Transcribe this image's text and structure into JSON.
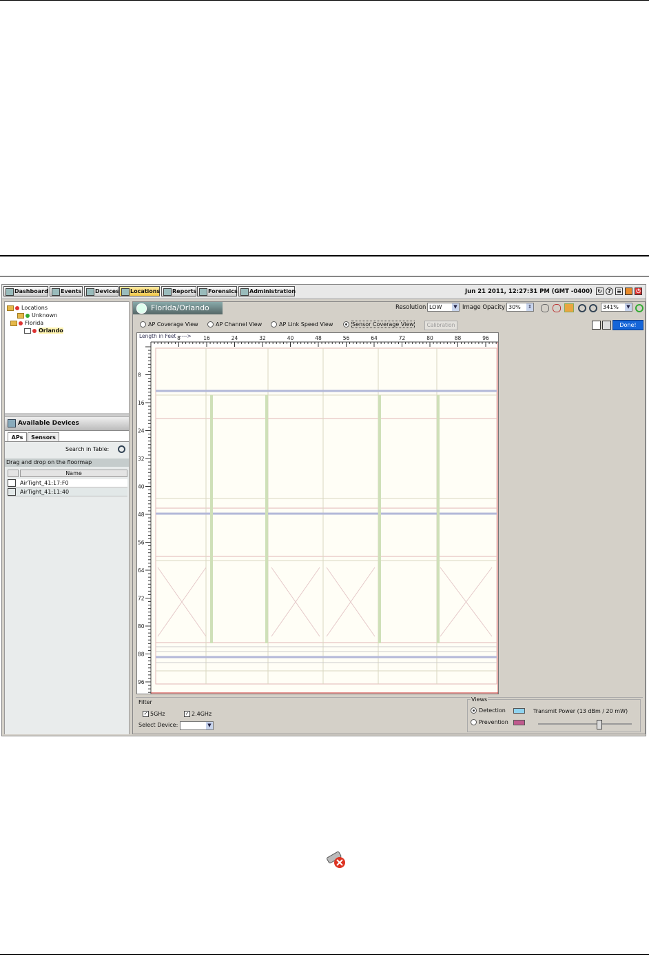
{
  "nav": [
    {
      "label": "Dashboard",
      "icon": "dashboard-icon"
    },
    {
      "label": "Events",
      "icon": "events-icon"
    },
    {
      "label": "Devices",
      "icon": "devices-icon"
    },
    {
      "label": "Locations",
      "icon": "locations-icon",
      "active": true
    },
    {
      "label": "Reports",
      "icon": "reports-icon"
    },
    {
      "label": "Forensics",
      "icon": "forensics-icon"
    },
    {
      "label": "Administration",
      "icon": "administration-icon"
    }
  ],
  "datetime": "Jun 21 2011, 12:27:31 PM (GMT -0400)",
  "tree": {
    "root": "Locations",
    "items": [
      {
        "label": "Unknown",
        "status": "green"
      },
      {
        "label": "Florida",
        "status": "red"
      },
      {
        "label": "Orlando",
        "status": "red",
        "selected": true
      }
    ]
  },
  "available_devices": {
    "title": "Available Devices",
    "tabs": [
      "APs",
      "Sensors"
    ],
    "search_label": "Search in Table:",
    "hint": "Drag and drop on the floormap",
    "column_name": "Name",
    "rows": [
      "AirTight_41:17:F0",
      "AirTight_41:11:40"
    ]
  },
  "location_title": "Florida/Orlando",
  "toolbar": {
    "resolution_label": "Resolution",
    "resolution_value": "LOW",
    "opacity_label": "Image Opacity",
    "opacity_value": "30%",
    "zoom_value": "341%"
  },
  "views": [
    "AP Coverage View",
    "AP Channel View",
    "AP Link Speed View",
    "Sensor Coverage View"
  ],
  "selected_view": "Sensor Coverage View",
  "calibration_label": "Calibration",
  "done_label": "Done!",
  "ruler": {
    "caption": "Length in Feet ----->",
    "x_ticks": [
      "8",
      "16",
      "24",
      "32",
      "40",
      "48",
      "56",
      "64",
      "72",
      "80",
      "88",
      "96"
    ],
    "y_ticks": [
      "8",
      "16",
      "24",
      "32",
      "40",
      "48",
      "56",
      "64",
      "72",
      "80",
      "88",
      "96"
    ]
  },
  "filter": {
    "title": "Filter",
    "band_5": "5GHz",
    "band_24": "2.4GHz",
    "select_device_label": "Select Device:"
  },
  "views_panel": {
    "title": "Views",
    "detection": "Detection",
    "prevention": "Prevention",
    "transmit_power": "Transmit Power  (13 dBm / 20 mW)",
    "detection_color": "#8fd3ef",
    "prevention_color": "#c05a8e",
    "transmit_level": 0.65
  }
}
